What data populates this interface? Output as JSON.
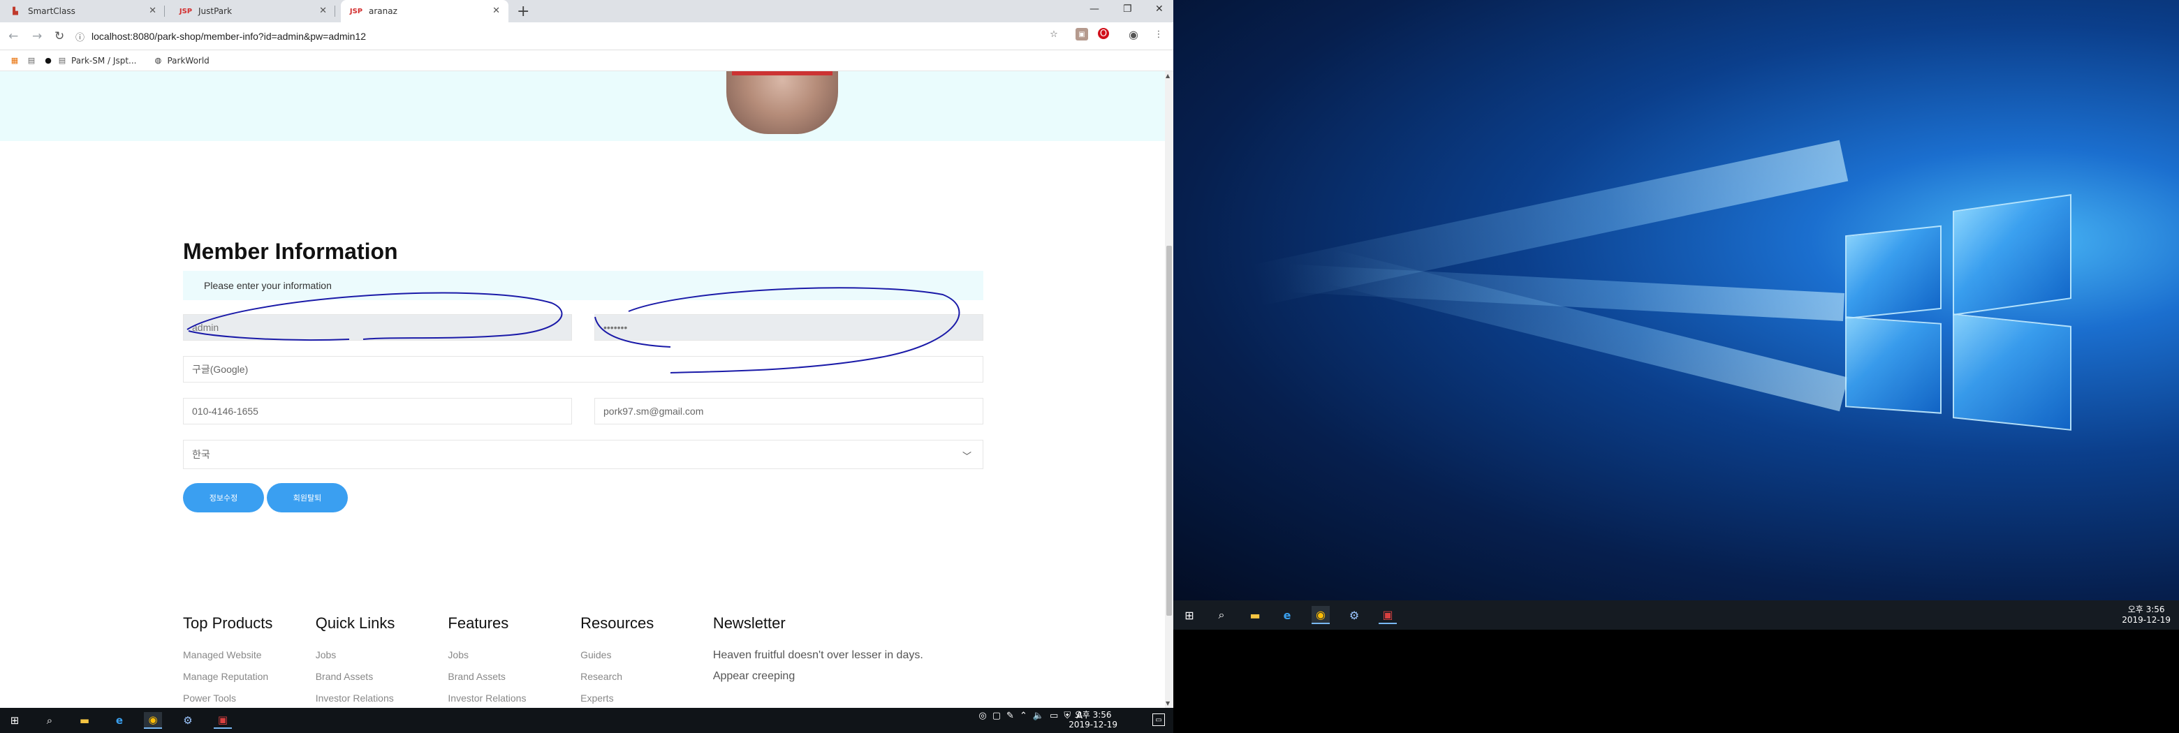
{
  "browser": {
    "tabs": [
      {
        "label": "SmartClass",
        "favicon": "smartclass-icon"
      },
      {
        "label": "JustPark",
        "favicon": "jsp-icon"
      },
      {
        "label": "aranaz",
        "favicon": "jsp-icon"
      }
    ],
    "url": "localhost:8080/park-shop/member-info?id=admin&pw=admin12",
    "bookmarks": [
      "Park-SM / Jspt...",
      "ParkWorld"
    ]
  },
  "page": {
    "title": "Member Information",
    "notice": "Please enter your information",
    "fields": {
      "id": "admin",
      "password": "•••••••",
      "name_placeholder": "구글(Google)",
      "phone": "010-4146-1655",
      "email": "pork97.sm@gmail.com",
      "country": "한국"
    },
    "buttons": {
      "update": "정보수정",
      "withdraw": "회원탈퇴"
    },
    "footer": {
      "columns": [
        {
          "heading": "Top Products",
          "links": [
            "Managed Website",
            "Manage Reputation",
            "Power Tools"
          ]
        },
        {
          "heading": "Quick Links",
          "links": [
            "Jobs",
            "Brand Assets",
            "Investor Relations"
          ]
        },
        {
          "heading": "Features",
          "links": [
            "Jobs",
            "Brand Assets",
            "Investor Relations"
          ]
        },
        {
          "heading": "Resources",
          "links": [
            "Guides",
            "Research",
            "Experts"
          ]
        }
      ],
      "newsletter": {
        "heading": "Newsletter",
        "lines": [
          "Heaven fruitful doesn't over lesser in days.",
          "Appear creeping"
        ]
      }
    }
  },
  "taskbar_left": {
    "time": "오후 3:56",
    "date": "2019-12-19"
  },
  "taskbar_right": {
    "time": "오후 3:56",
    "date": "2019-12-19"
  },
  "colors": {
    "accent": "#3a9ff1",
    "annotation": "#1a1aa8",
    "hero": "#eafcfd"
  }
}
